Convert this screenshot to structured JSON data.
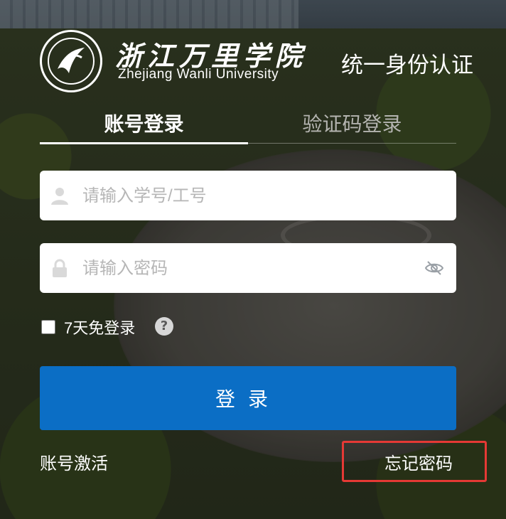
{
  "school": {
    "name_cn": "浙江万里学院",
    "name_en": "Zhejiang Wanli University"
  },
  "site_title": "统一身份认证",
  "tabs": [
    {
      "label": "账号登录",
      "active": true
    },
    {
      "label": "验证码登录",
      "active": false
    }
  ],
  "form": {
    "username_placeholder": "请输入学号/工号",
    "password_placeholder": "请输入密码",
    "remember_label": "7天免登录",
    "remember_checked": false,
    "help_symbol": "?",
    "login_label": "登录"
  },
  "links": {
    "activate": "账号激活",
    "forgot_password": "忘记密码"
  },
  "colors": {
    "primary": "#0b6ec5",
    "highlight_box": "#e53935"
  }
}
